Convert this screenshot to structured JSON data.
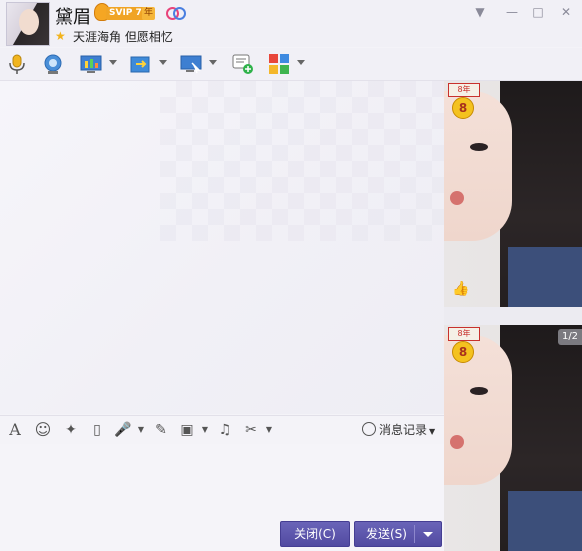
{
  "header": {
    "name": "黛眉",
    "vip_label": "SVIP 7",
    "vip_year": "年",
    "signature": "天涯海角 但愿相忆",
    "icons": [
      "avatar",
      "vip-crown-icon",
      "qq-couple-icon",
      "star-icon"
    ]
  },
  "window_controls": {
    "dropdown": "▼",
    "minimize": "—",
    "maximize": "□",
    "close": "✕"
  },
  "toolbar": {
    "items": [
      {
        "name": "voice-call-icon",
        "has_arrow": false
      },
      {
        "name": "video-call-icon",
        "has_arrow": false
      },
      {
        "name": "remote-desktop-icon",
        "has_arrow": true
      },
      {
        "name": "send-file-icon",
        "has_arrow": true
      },
      {
        "name": "screen-share-icon",
        "has_arrow": true
      },
      {
        "name": "create-discussion-icon",
        "has_arrow": false
      },
      {
        "name": "app-grid-icon",
        "has_arrow": true
      }
    ]
  },
  "format_bar": {
    "font": "A",
    "emoji": "☺",
    "magic": "✦",
    "shake": "▯",
    "voice": "🎤",
    "edit": "✎",
    "image": "▣",
    "music": "♫",
    "screenshot": "✂",
    "history_label": "消息记录"
  },
  "buttons": {
    "close_label": "关闭(C)",
    "send_label": "发送(S)"
  },
  "side_panel": {
    "badge_top": "8年",
    "badge_number": "8",
    "page_indicator": "1/2"
  },
  "colors": {
    "button": "#514aa1",
    "accent_vip": "#f0a425",
    "background": "#f4f3f8"
  }
}
